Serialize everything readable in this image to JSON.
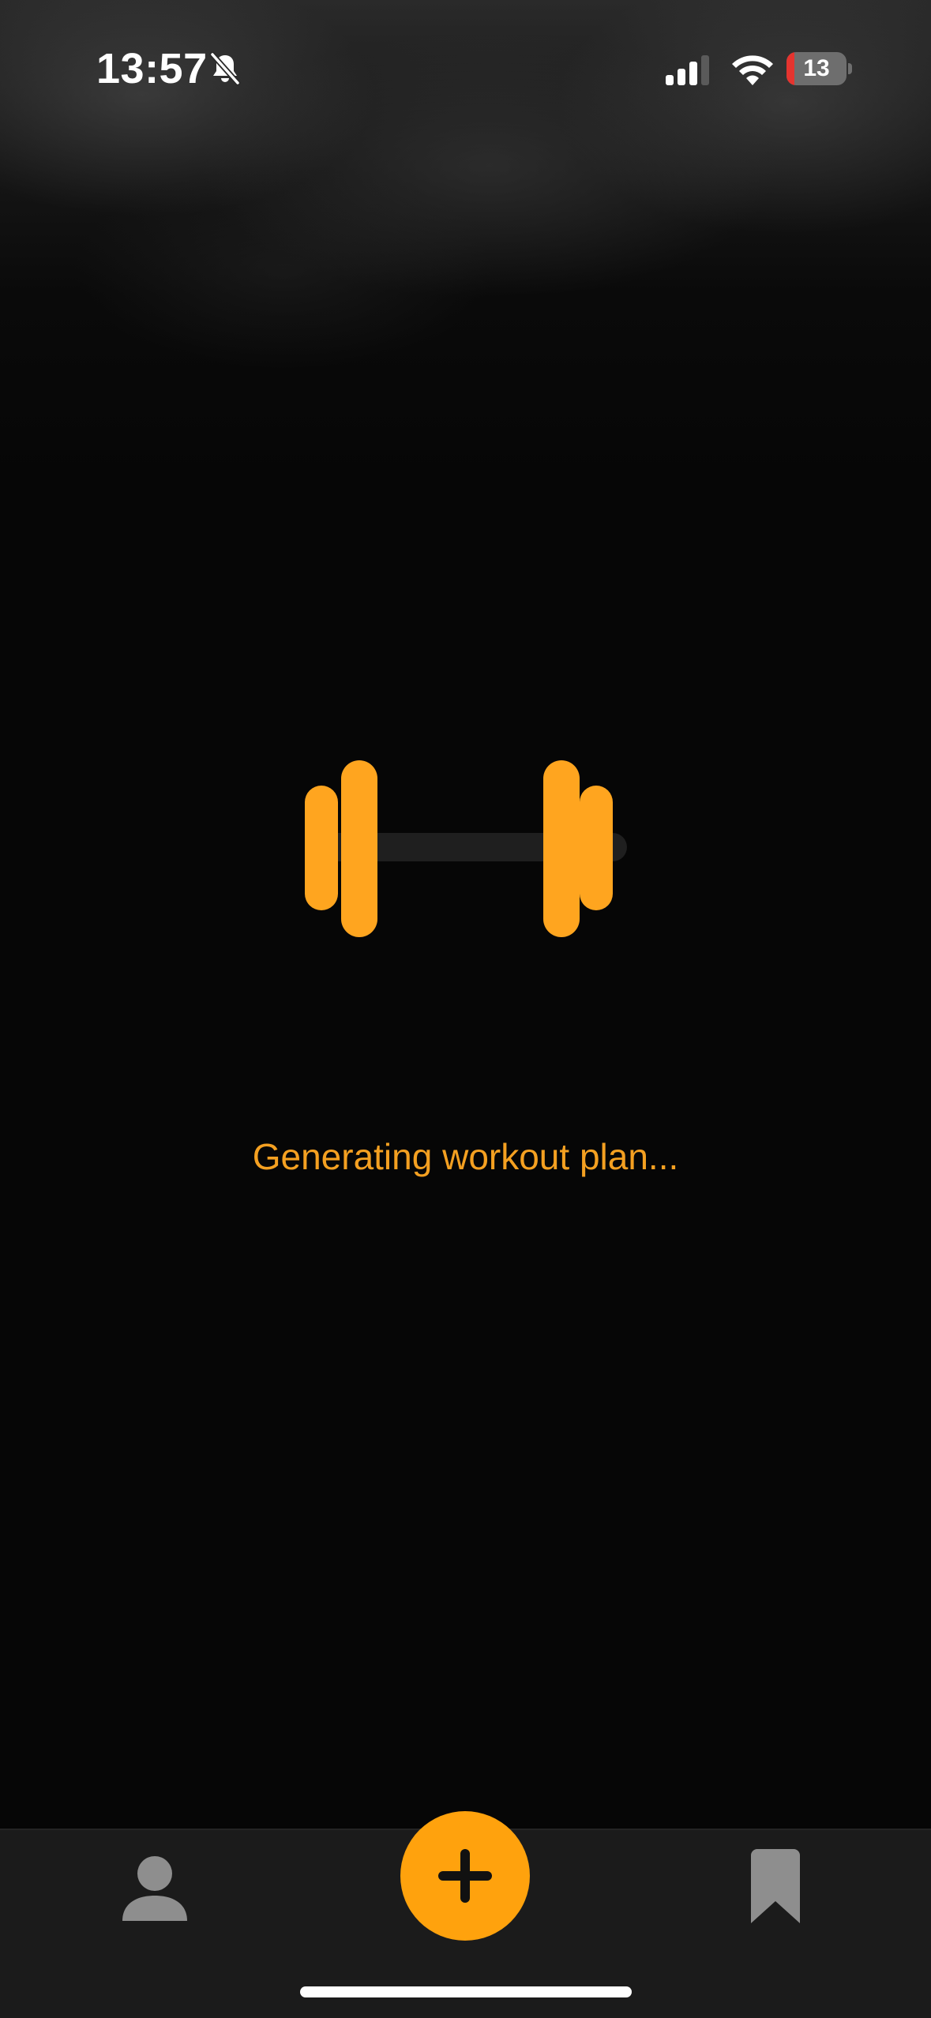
{
  "status_bar": {
    "time": "13:57",
    "battery_level": "13",
    "icons": [
      "bell-slash-icon",
      "cellular-signal-icon",
      "wifi-icon",
      "battery-icon"
    ]
  },
  "main": {
    "loading_icon": "dumbbell-icon",
    "loading_message": "Generating workout plan..."
  },
  "tab_bar": {
    "items": [
      {
        "icon": "person-icon",
        "active": false
      },
      {
        "icon": "plus-icon",
        "active": true
      },
      {
        "icon": "bookmark-icon",
        "active": false
      }
    ]
  },
  "colors": {
    "accent": "#ffa20d",
    "loading_text": "#f4a021",
    "background": "#060606",
    "tab_bar_background": "#1b1b1b",
    "inactive_icon": "#8e8e8e",
    "battery_low": "#e5342f"
  }
}
